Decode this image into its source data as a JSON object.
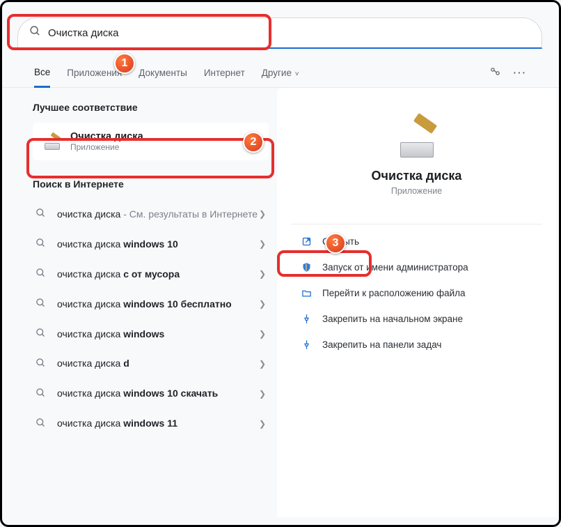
{
  "search": {
    "query": "Очистка диска"
  },
  "tabs": {
    "items": [
      "Все",
      "Приложения",
      "Документы",
      "Интернет",
      "Другие"
    ]
  },
  "sections": {
    "best_label": "Лучшее соответствие",
    "web_label": "Поиск в Интернете"
  },
  "best_match": {
    "title": "Очистка диска",
    "subtitle": "Приложение"
  },
  "web_results": [
    {
      "prefix": "очистка диска",
      "bold": "",
      "suffix": " - См. результаты в Интернете"
    },
    {
      "prefix": "очистка диска ",
      "bold": "windows 10",
      "suffix": ""
    },
    {
      "prefix": "очистка диска ",
      "bold": "с от мусора",
      "suffix": ""
    },
    {
      "prefix": "очистка диска ",
      "bold": "windows 10 бесплатно",
      "suffix": ""
    },
    {
      "prefix": "очистка диска ",
      "bold": "windows",
      "suffix": ""
    },
    {
      "prefix": "очистка диска ",
      "bold": "d",
      "suffix": ""
    },
    {
      "prefix": "очистка диска ",
      "bold": "windows 10 скачать",
      "suffix": ""
    },
    {
      "prefix": "очистка диска ",
      "bold": "windows 11",
      "suffix": ""
    }
  ],
  "detail": {
    "title": "Очистка диска",
    "subtitle": "Приложение"
  },
  "actions": [
    {
      "icon": "open",
      "label": "Открыть"
    },
    {
      "icon": "shield",
      "label": "Запуск от имени администратора"
    },
    {
      "icon": "folder",
      "label": "Перейти к расположению файла"
    },
    {
      "icon": "pin",
      "label": "Закрепить на начальном экране"
    },
    {
      "icon": "pin",
      "label": "Закрепить на панели задач"
    }
  ],
  "annotations": {
    "b1": "1",
    "b2": "2",
    "b3": "3"
  }
}
